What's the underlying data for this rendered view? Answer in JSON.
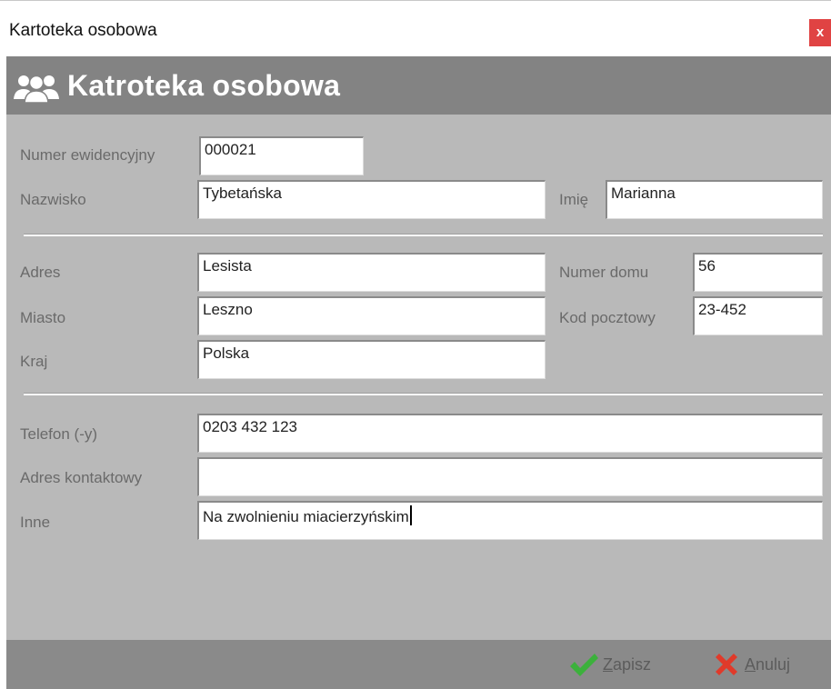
{
  "window": {
    "title": "Kartoteka osobowa",
    "close_label": "x"
  },
  "header": {
    "title": "Katroteka osobowa",
    "icon": "people-icon"
  },
  "form": {
    "numer_ewidencyjny": {
      "label": "Numer ewidencyjny",
      "value": "000021"
    },
    "nazwisko": {
      "label": "Nazwisko",
      "value": "Tybetańska"
    },
    "imie": {
      "label": "Imię",
      "value": "Marianna"
    },
    "adres": {
      "label": "Adres",
      "value": "Lesista"
    },
    "numer_domu": {
      "label": "Numer domu",
      "value": "56"
    },
    "miasto": {
      "label": "Miasto",
      "value": "Leszno"
    },
    "kod_pocztowy": {
      "label": "Kod pocztowy",
      "value": "23-452"
    },
    "kraj": {
      "label": "Kraj",
      "value": "Polska"
    },
    "telefon": {
      "label": "Telefon (-y)",
      "value": "0203 432 123"
    },
    "adres_kontaktowy": {
      "label": "Adres kontaktowy",
      "value": ""
    },
    "inne": {
      "label": "Inne",
      "value": "Na zwolnieniu miacierzyńskim"
    }
  },
  "footer": {
    "save": {
      "hotkey": "Z",
      "rest": "apisz",
      "icon": "checkmark-icon"
    },
    "cancel": {
      "hotkey": "A",
      "rest": "nuluj",
      "icon": "cancel-x-icon"
    }
  },
  "colors": {
    "header_band": "#838383",
    "form_background": "#b9b9b9",
    "footer_band": "#8a8a8a",
    "close_button": "#e04343",
    "save_icon": "#3cb13c",
    "cancel_icon": "#e03a2a"
  }
}
